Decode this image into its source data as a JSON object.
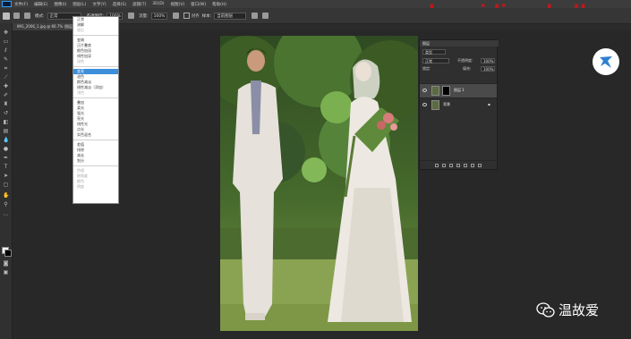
{
  "menubar": {
    "items": [
      "文件(F)",
      "编辑(E)",
      "图像(I)",
      "图层(L)",
      "文字(Y)",
      "选择(S)",
      "滤镜(T)",
      "3D(D)",
      "视图(V)",
      "窗口(W)",
      "帮助(H)"
    ]
  },
  "watermark": {
    "text": "www.hacyidianshell.com",
    "color": "#c9161b"
  },
  "options": {
    "mode_label": "模式:",
    "mode_value": "正常",
    "opacity_label": "不透明度:",
    "opacity_value": "100%",
    "flow_label": "流量:",
    "flow_value": "100%",
    "sample_label": "样本:",
    "sample_value": "当前图层",
    "aligned_label": "对齐"
  },
  "document": {
    "tab_title": "IMG_2006_1.jpg @ 66.7% (图层 1, RGB/8#)"
  },
  "blend_dropdown": {
    "groups": [
      [
        {
          "label": "正常"
        },
        {
          "label": "溶解"
        },
        {
          "label": "背后",
          "dim": true
        }
      ],
      [
        {
          "label": "变暗"
        },
        {
          "label": "正片叠底"
        },
        {
          "label": "颜色加深"
        },
        {
          "label": "线性加深"
        },
        {
          "label": "深色",
          "dim": true
        }
      ],
      [
        {
          "label": "变亮",
          "selected": true
        },
        {
          "label": "滤色"
        },
        {
          "label": "颜色减淡"
        },
        {
          "label": "线性减淡（添加）"
        },
        {
          "label": "浅色",
          "dim": true
        }
      ],
      [
        {
          "label": "叠加"
        },
        {
          "label": "柔光"
        },
        {
          "label": "强光"
        },
        {
          "label": "亮光"
        },
        {
          "label": "线性光"
        },
        {
          "label": "点光"
        },
        {
          "label": "实色混合"
        }
      ],
      [
        {
          "label": "差值"
        },
        {
          "label": "排除"
        },
        {
          "label": "减去"
        },
        {
          "label": "划分"
        }
      ],
      [
        {
          "label": "色相",
          "dim": true
        },
        {
          "label": "饱和度",
          "dim": true
        },
        {
          "label": "颜色",
          "dim": true
        },
        {
          "label": "明度",
          "dim": true
        }
      ]
    ]
  },
  "layers_panel": {
    "title": "图层",
    "filter_label": "类型",
    "blend_value": "正常",
    "opacity_label": "不透明度:",
    "opacity_value": "100%",
    "lock_label": "锁定:",
    "fill_label": "填充:",
    "fill_value": "100%",
    "layers": [
      {
        "name": "图层 1",
        "active": true
      },
      {
        "name": "背景",
        "active": false
      }
    ]
  },
  "wechat": {
    "name": "温故爱"
  },
  "colors": {
    "accent": "#3c8fd9",
    "panel_bg": "#2f2f2f",
    "canvas_bg": "#282828"
  }
}
